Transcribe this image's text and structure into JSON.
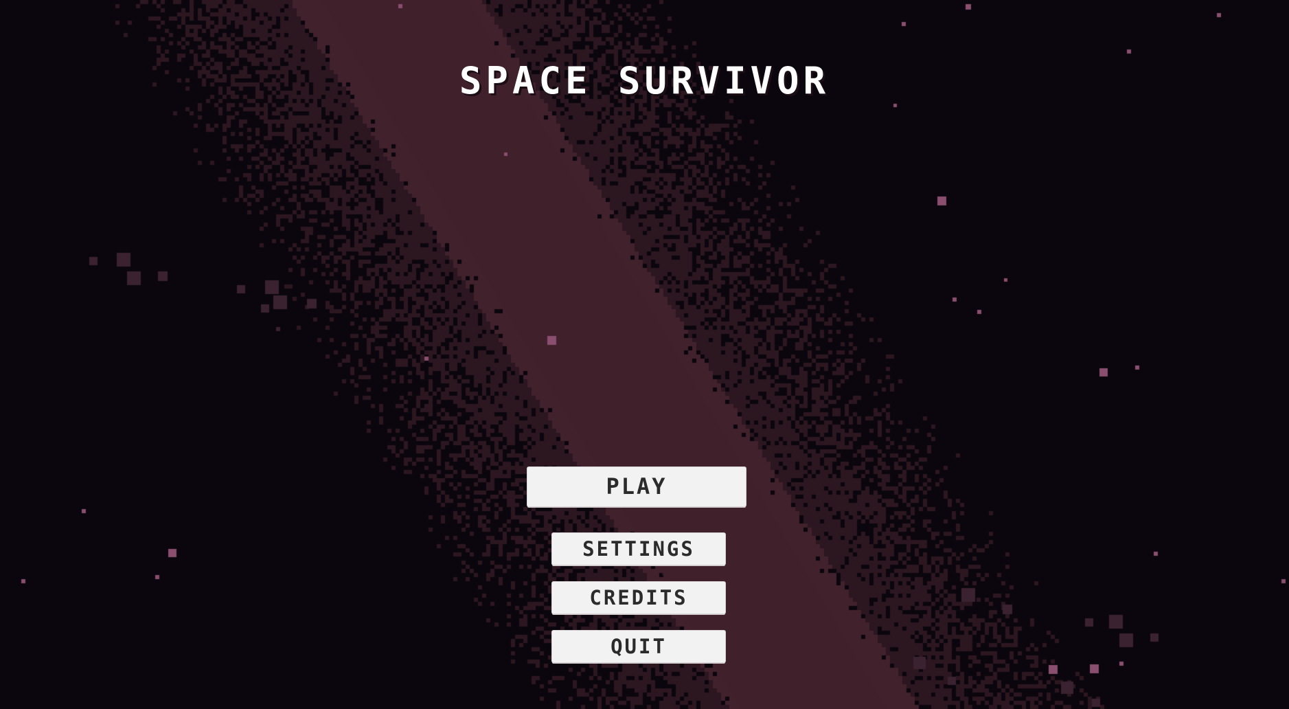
{
  "game": {
    "title": "SPACE SURVIVOR"
  },
  "menu": {
    "play_label": "PLAY",
    "settings_label": "SETTINGS",
    "credits_label": "CREDITS",
    "quit_label": "QUIT"
  },
  "colors": {
    "background": "#0b060d",
    "nebula_core": "#40212c",
    "nebula_mid": "#2c1620",
    "star": "#8a4e6e",
    "button_bg": "#f2f2f2",
    "button_text": "#2b2b2b",
    "title_text": "#ffffff"
  }
}
